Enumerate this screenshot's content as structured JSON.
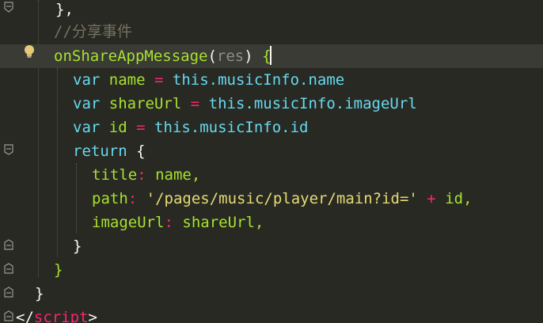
{
  "editor": {
    "lines": {
      "l0": {
        "close_brace": "},"
      },
      "l1": {
        "comment": "//分享事件"
      },
      "l2": {
        "func_name": "onShareAppMessage",
        "paren_open": "(",
        "param": "res",
        "paren_close": ")",
        "space": " ",
        "brace": "{"
      },
      "l3": {
        "kw": "var",
        "name": "name",
        "eq": "=",
        "rhs": "this.musicInfo.name"
      },
      "l4": {
        "kw": "var",
        "name": "shareUrl",
        "eq": "=",
        "rhs": "this.musicInfo.imageUrl"
      },
      "l5": {
        "kw": "var",
        "name": "id",
        "eq": "=",
        "rhs": "this.musicInfo.id"
      },
      "l6": {
        "kw": "return",
        "brace": "{"
      },
      "l7": {
        "key": "title",
        "colon": ":",
        "value": "name,"
      },
      "l8": {
        "key": "path",
        "colon": ":",
        "str": "'/pages/music/player/main?id='",
        "plus": "+",
        "value": "id,"
      },
      "l9": {
        "key": "imageUrl",
        "colon": ":",
        "value": "shareUrl,"
      },
      "l10": {
        "close": "}"
      },
      "l11": {
        "close": "}"
      },
      "l12": {
        "close": "}"
      },
      "l13": {
        "lt": "</",
        "tag": "script",
        "gt": ">"
      }
    },
    "colors": {
      "background": "#282923",
      "keyword": "#66d9ef",
      "function": "#a6e22e",
      "string": "#e6db74",
      "operator": "#f92672",
      "comment": "#75715e"
    },
    "icons": [
      "fold-marker-icon",
      "lightbulb-icon"
    ]
  }
}
